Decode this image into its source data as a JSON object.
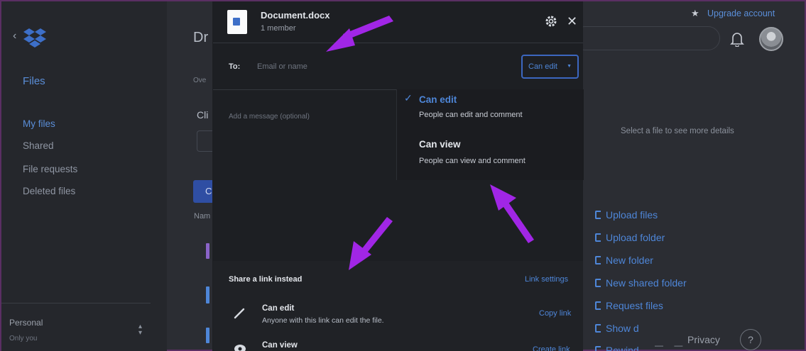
{
  "sidebar": {
    "title": "Files",
    "items": [
      {
        "label": "My files",
        "active": true
      },
      {
        "label": "Shared"
      },
      {
        "label": "File requests"
      },
      {
        "label": "Deleted files"
      }
    ],
    "account": {
      "label": "Personal",
      "sublabel": "Only you"
    }
  },
  "main": {
    "title_fragment": "Dr",
    "subtitle_fragment": "Ove",
    "cli_fragment": "Cli",
    "button_fragment": "C",
    "name_fragment": "Nam"
  },
  "header": {
    "upgrade_label": "Upgrade account"
  },
  "detail_pane": {
    "hint": "Select a file to see more details",
    "actions": [
      "Upload files",
      "Upload folder",
      "New folder",
      "New shared folder",
      "Request files",
      "Show d",
      "Rewind"
    ]
  },
  "footer": {
    "privacy": "Privacy",
    "help": "?",
    "dashes": "— —"
  },
  "modal": {
    "file_name": "Document.docx",
    "members": "1 member",
    "to_label": "To:",
    "email_placeholder": "Email or name",
    "permission": "Can edit",
    "message_placeholder": "Add a message (optional)",
    "dropdown": [
      {
        "title": "Can edit",
        "desc": "People can edit and comment",
        "selected": true
      },
      {
        "title": "Can view",
        "desc": "People can view and comment",
        "selected": false
      }
    ],
    "check": "✓",
    "share": {
      "header": "Share a link instead",
      "settings": "Link settings",
      "links": [
        {
          "title": "Can edit",
          "desc": "Anyone with this link can edit the file.",
          "action": "Copy link"
        },
        {
          "title": "Can view",
          "desc": "",
          "action": "Create link"
        }
      ]
    }
  },
  "colors": {
    "accent": "#4e86d8",
    "annotation": "#a126e6",
    "modal_bg": "#1d1f23",
    "page_bg": "#2b2d33"
  }
}
